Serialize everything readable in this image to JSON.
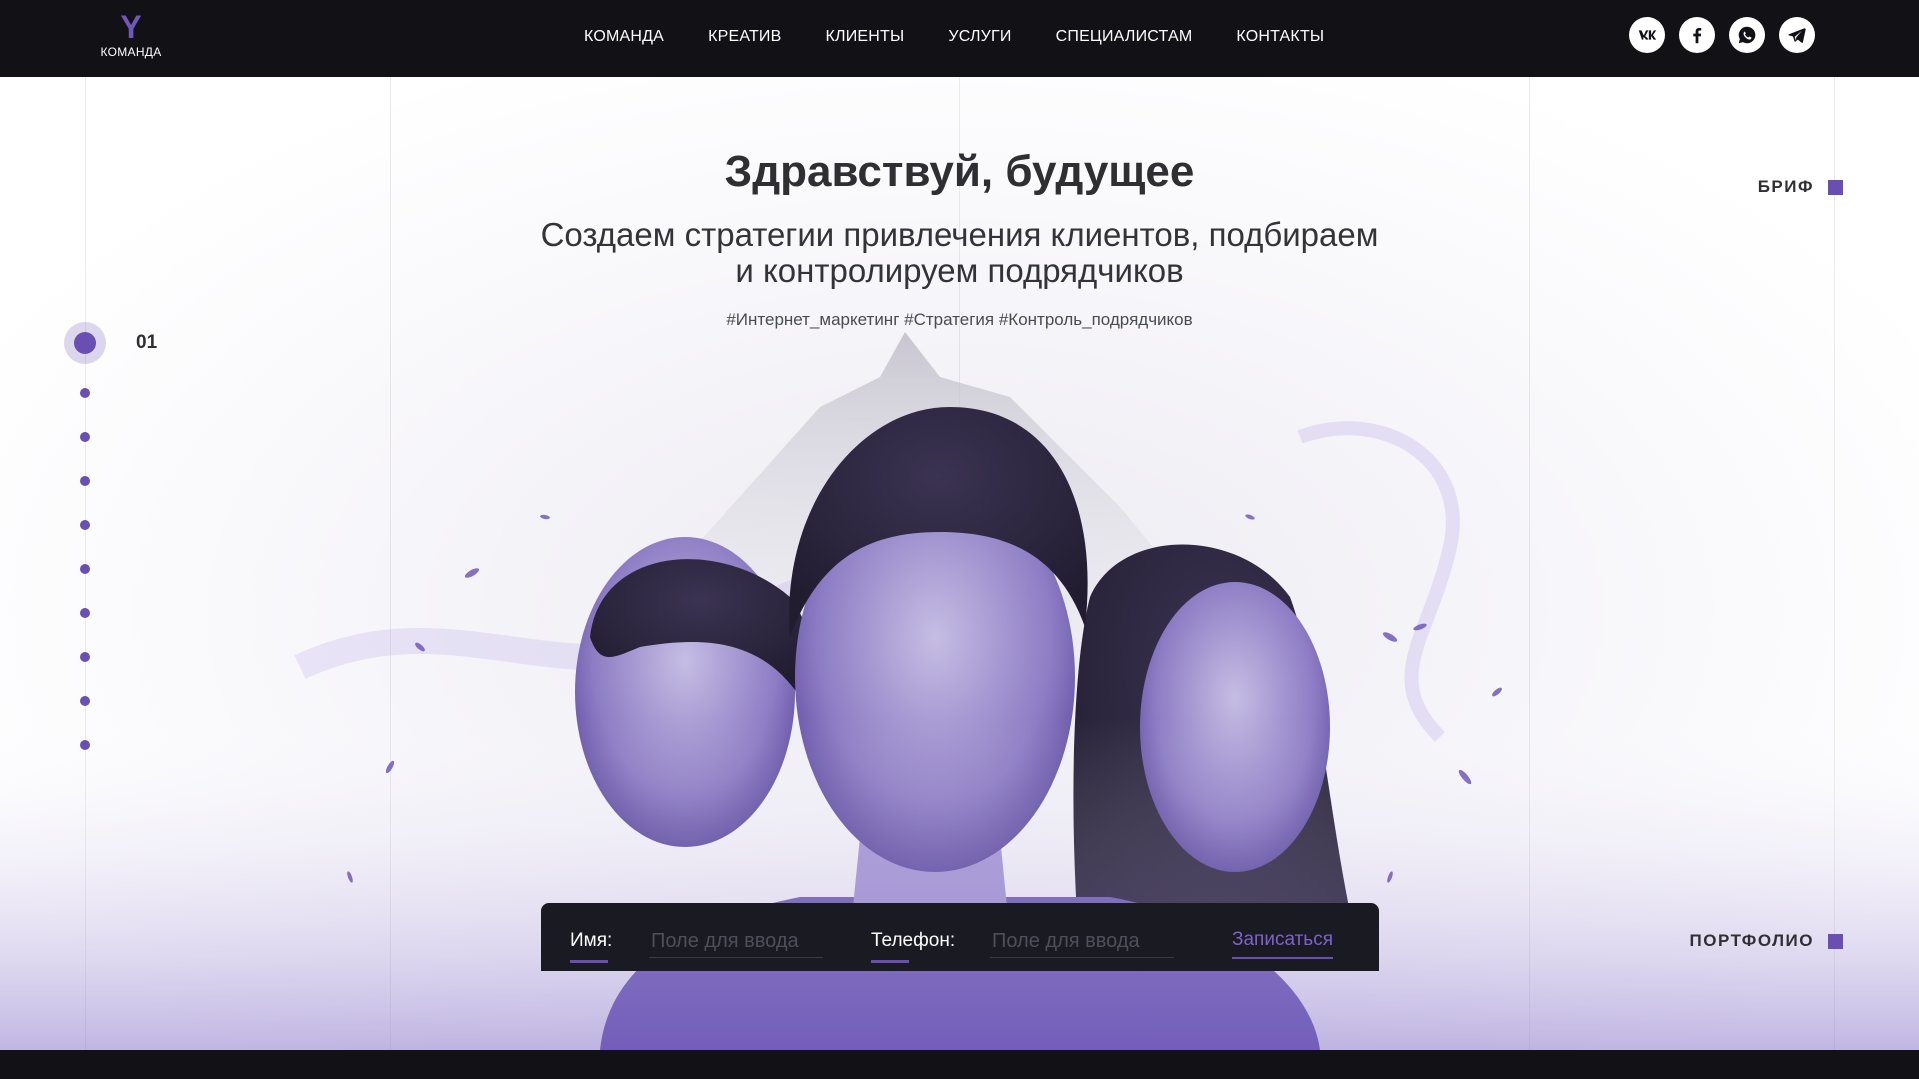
{
  "logo": {
    "mark": "Y",
    "text": "КОМАНДА"
  },
  "nav": [
    "КОМАНДА",
    "КРЕАТИВ",
    "КЛИЕНТЫ",
    "УСЛУГИ",
    "СПЕЦИАЛИСТАМ",
    "КОНТАКТЫ"
  ],
  "social": {
    "vk": "vk-icon",
    "facebook": "facebook-icon",
    "whatsapp": "whatsapp-icon",
    "telegram": "telegram-icon"
  },
  "hero": {
    "title": "Здравствуй, будущее",
    "subtitle_line1": "Создаем стратегии привлечения клиентов, подбираем",
    "subtitle_line2": "и контролируем подрядчиков",
    "tags": "#Интернет_маркетинг #Стратегия #Контроль_подрядчиков"
  },
  "side_links": {
    "brief": "БРИФ",
    "portfolio": "ПОРТФОЛИО"
  },
  "slider": {
    "current": "01",
    "total_dots": 9
  },
  "form": {
    "name_label": "Имя:",
    "name_placeholder": "Поле для ввода",
    "phone_label": "Телефон:",
    "phone_placeholder": "Поле для ввода",
    "submit": "Записаться"
  },
  "colors": {
    "accent": "#6a4fb3",
    "dark": "#111116",
    "form_bg": "#1a1a22"
  }
}
